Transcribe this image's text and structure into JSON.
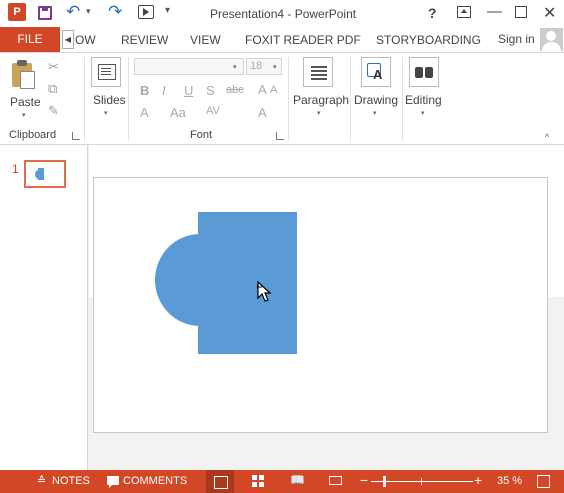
{
  "window": {
    "title": "Presentation4 - PowerPoint",
    "app_logo": "P",
    "help": "?",
    "min_icon": "—",
    "close_icon": "✕",
    "undo_icon": "↶",
    "redo_icon": "↷",
    "dd_icon": "▾"
  },
  "tabs": {
    "file": "FILE",
    "scroll_left": "◀",
    "items": [
      "OW",
      "REVIEW",
      "VIEW",
      "FOXIT READER PDF",
      "STORYBOARDING"
    ],
    "signin": "Sign in"
  },
  "ribbon": {
    "clipboard": {
      "label": "Clipboard",
      "paste": "Paste",
      "cut_icon": "✂",
      "copy_icon": "⧉",
      "painter_icon": "✎"
    },
    "slides": {
      "label": "Slides"
    },
    "font": {
      "label": "Font",
      "size": "18",
      "bold": "B",
      "italic": "I",
      "underline": "U",
      "shadow": "S",
      "strike": "abc",
      "grow": "A",
      "shrink": "A",
      "color": "A",
      "case": "Aa",
      "spacing": "AV",
      "clear": "A"
    },
    "paragraph": {
      "label": "Paragraph"
    },
    "drawing": {
      "label": "Drawing"
    },
    "editing": {
      "label": "Editing"
    },
    "caret": "▾",
    "collapse_icon": "^"
  },
  "thumbs": {
    "slide_number": "1"
  },
  "status": {
    "notes": "NOTES",
    "comments": "COMMENTS",
    "zoom": "35 %",
    "zoom_level": 0.35,
    "zoom_minus": "−",
    "zoom_plus": "+",
    "notes_icon": "≙",
    "reading_icon": "📖"
  },
  "colors": {
    "accent": "#d24726",
    "shape_fill": "#5b9bd5"
  }
}
